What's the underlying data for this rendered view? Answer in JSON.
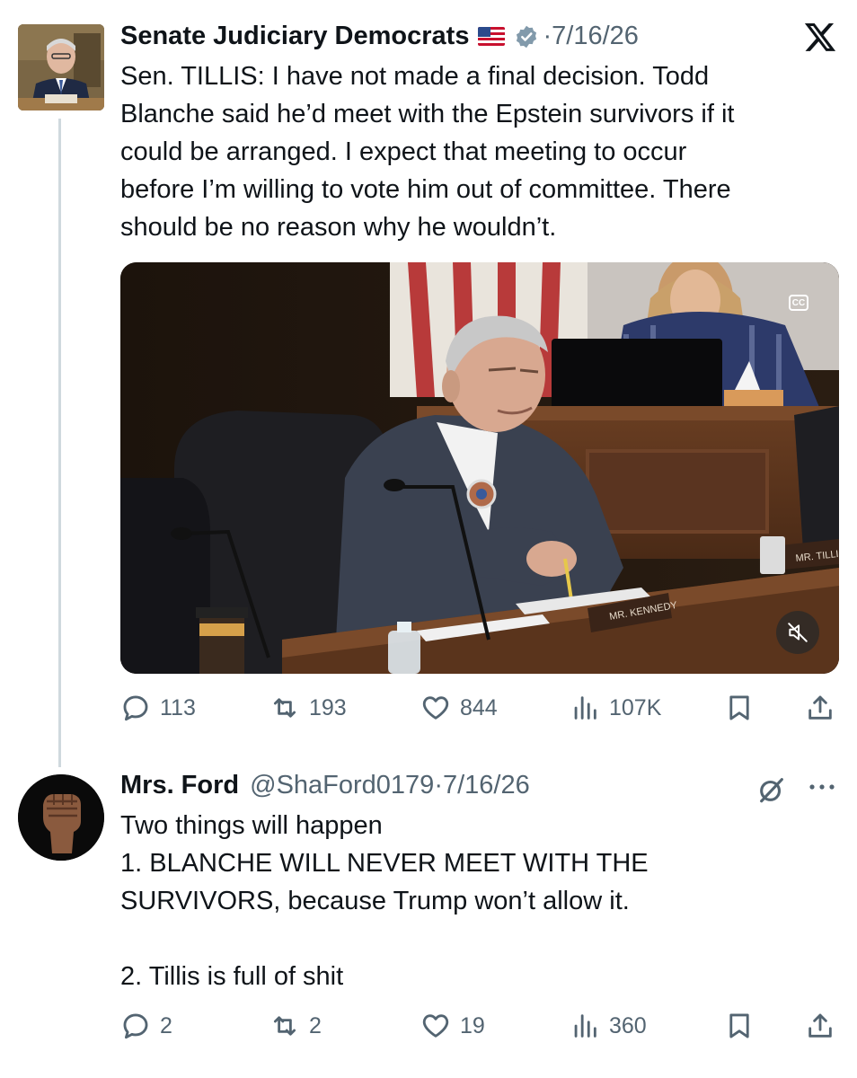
{
  "tweet1": {
    "name": "Senate Judiciary Democrats",
    "sep": "·",
    "date": "7/16/26",
    "text": "Sen. TILLIS: I have not made a final decision. Todd\nBlanche said he’d meet with the Epstein survivors if it\ncould be arranged. I expect that meeting to occur\nbefore I’m willing to vote him out of committee. There\nshould be no reason why he wouldn’t.",
    "media": {
      "cc_label": "CC",
      "nameplates": [
        "MR. KENNEDY",
        "MR. TILLIS"
      ]
    },
    "actions": {
      "replies": "113",
      "reposts": "193",
      "likes": "844",
      "views": "107K"
    }
  },
  "tweet2": {
    "name": "Mrs. Ford",
    "handle": "@ShaFord0179",
    "sep": "·",
    "date": "7/16/26",
    "text": "Two things will happen\n1. BLANCHE WILL NEVER MEET WITH THE\nSURVIVORS, because Trump won’t allow it.\n\n2. Tillis is full of shit",
    "actions": {
      "replies": "2",
      "reposts": "2",
      "likes": "19",
      "views": "360"
    }
  },
  "icons": {
    "reply": "reply-icon",
    "repost": "repost-icon",
    "like": "heart-icon",
    "views": "views-icon",
    "bookmark": "bookmark-icon",
    "share": "share-icon",
    "x_logo": "x-logo-icon",
    "verified": "verified-badge-icon",
    "flag": "us-flag-icon",
    "mute": "mute-icon",
    "more": "more-icon",
    "grok": "grok-icon"
  },
  "colors": {
    "text": "#0f1419",
    "muted": "#536471",
    "thread_line": "#cfd9de",
    "verified": "#829aab"
  }
}
